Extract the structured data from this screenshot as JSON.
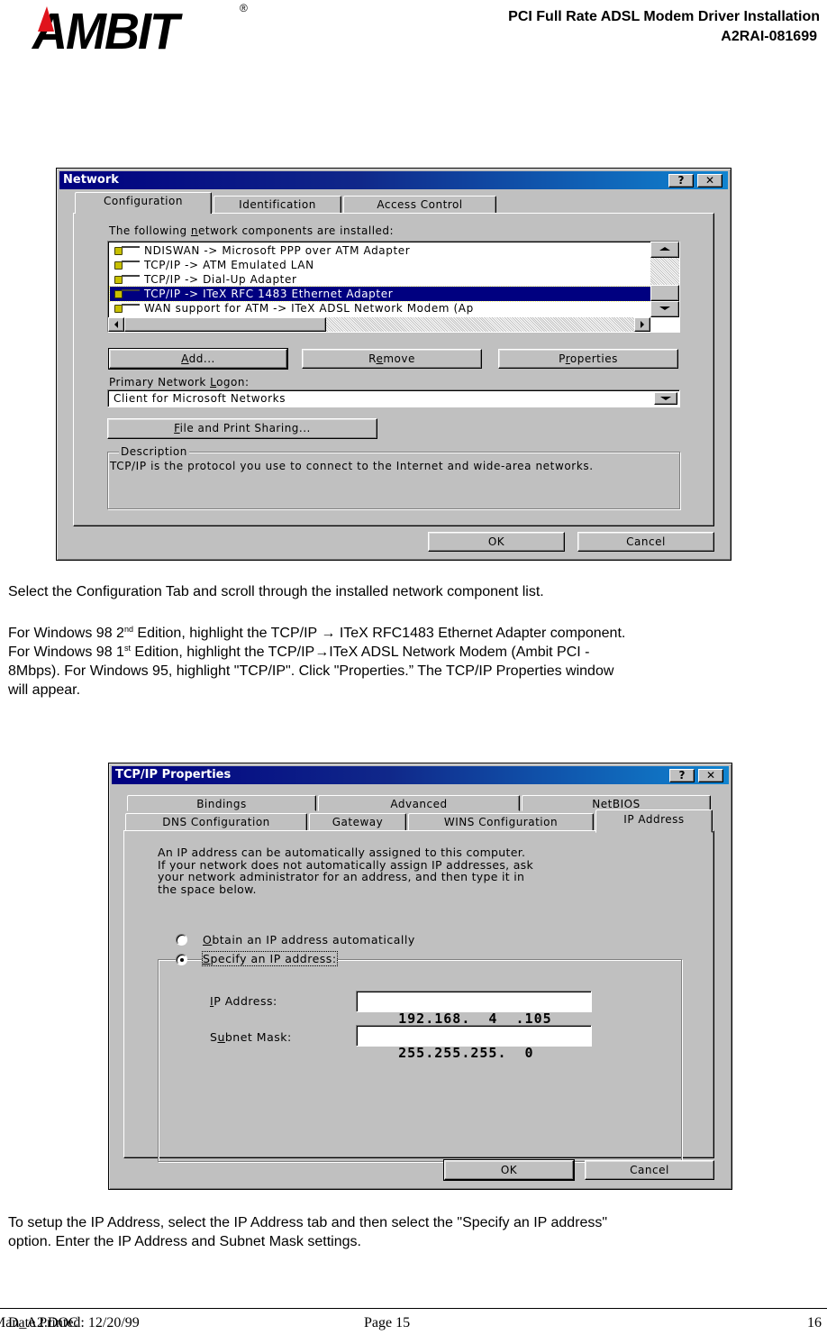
{
  "header": {
    "logo_text": "AMBIT",
    "registered_mark": "®",
    "title": "PCI Full Rate ADSL Modem Driver Installation",
    "doc_code": "A2RAI-081699",
    "brand_colors": {
      "logo": "#000000",
      "accent": "#e0141c"
    }
  },
  "network_dialog": {
    "title": "Network",
    "help_button": "?",
    "close_button": "✕",
    "tabs": [
      {
        "label": "Configuration",
        "underline": "",
        "active": true
      },
      {
        "label": "Identification",
        "active": false
      },
      {
        "label": "Access Control",
        "active": false
      }
    ],
    "components_label_pre": "The following ",
    "components_label_ul": "n",
    "components_label_post": "etwork components are installed:",
    "components": [
      {
        "icon": "network-adapter-icon",
        "label": "NDISWAN -> Microsoft PPP over ATM Adapter",
        "selected": false
      },
      {
        "icon": "network-adapter-icon",
        "label": "TCP/IP -> ATM Emulated LAN",
        "selected": false
      },
      {
        "icon": "network-adapter-icon",
        "label": "TCP/IP -> Dial-Up Adapter",
        "selected": false
      },
      {
        "icon": "network-adapter-icon",
        "label": "TCP/IP -> ITeX RFC 1483 Ethernet Adapter",
        "selected": true
      },
      {
        "icon": "network-adapter-icon",
        "label": "WAN support for ATM -> ITeX ADSL Network Modem (Ap",
        "selected": false
      }
    ],
    "buttons": {
      "add": {
        "ul": "A",
        "rest": "dd..."
      },
      "remove": {
        "pre": "R",
        "ul": "e",
        "rest": "move"
      },
      "properties": {
        "pre": "P",
        "ul": "r",
        "rest": "operties"
      }
    },
    "logon_label_pre": "Primary Network ",
    "logon_label_ul": "L",
    "logon_label_post": "ogon:",
    "logon_value": "Client for Microsoft Networks",
    "file_print": {
      "ul": "F",
      "rest": "ile and Print Sharing..."
    },
    "description_legend": "Description",
    "description_text": "TCP/IP is the protocol you use to connect to the Internet and wide-area networks.",
    "ok": "OK",
    "cancel": "Cancel",
    "title_colors": {
      "start": "#000080",
      "end": "#1084d0"
    }
  },
  "paragraph1": "Select the Configuration Tab and scroll through the installed network component list.",
  "paragraph2": {
    "l1_a": "For Windows 98 2",
    "l1_sup": "nd",
    "l1_b": " Edition, highlight the TCP/IP → ITeX RFC1483 Ethernet Adapter component.",
    "l2_a": "For Windows 98 1",
    "l2_sup": "st",
    "l2_b": " Edition, highlight the TCP/IP→ITeX ADSL Network Modem (Ambit PCI -",
    "l3": "8Mbps).  For Windows 95, highlight \"TCP/IP\".   Click \"Properties.”  The TCP/IP Properties window",
    "l4": "will appear."
  },
  "tcpip_dialog": {
    "title": "TCP/IP Properties",
    "help_button": "?",
    "close_button": "✕",
    "tabs_row1": [
      "Bindings",
      "Advanced",
      "NetBIOS"
    ],
    "tabs_row2": [
      "DNS Configuration",
      "Gateway",
      "WINS Configuration",
      "IP Address"
    ],
    "active_tab": "IP Address",
    "info_lines": [
      "An IP address can be automatically assigned to this computer.",
      "If your network does not automatically assign IP addresses, ask",
      "your network administrator for an address, and then type it in",
      "the space below."
    ],
    "radio_obtain": {
      "ul": "O",
      "rest": "btain an IP address automatically",
      "checked": false
    },
    "radio_specify": {
      "ul": "S",
      "rest": "pecify an IP address:",
      "checked": true
    },
    "ip_label": {
      "ul": "I",
      "rest": "P Address:"
    },
    "subnet_label": {
      "pre": "S",
      "ul": "u",
      "rest": "bnet Mask:"
    },
    "ip_value": "192.168.  4  .105",
    "subnet_value": "255.255.255.  0",
    "ok": "OK",
    "cancel": "Cancel"
  },
  "paragraph3": {
    "l1": "To setup the IP Address, select the IP Address tab and then select the \"Specify an IP address\"",
    "l2": "option.  Enter the IP Address and Subnet Mask settings."
  },
  "footer": {
    "date": "Date Printed: 12/20/99",
    "page": "Page 15",
    "doc": "Man_A2.DOC",
    "overlap_digits": "16"
  }
}
